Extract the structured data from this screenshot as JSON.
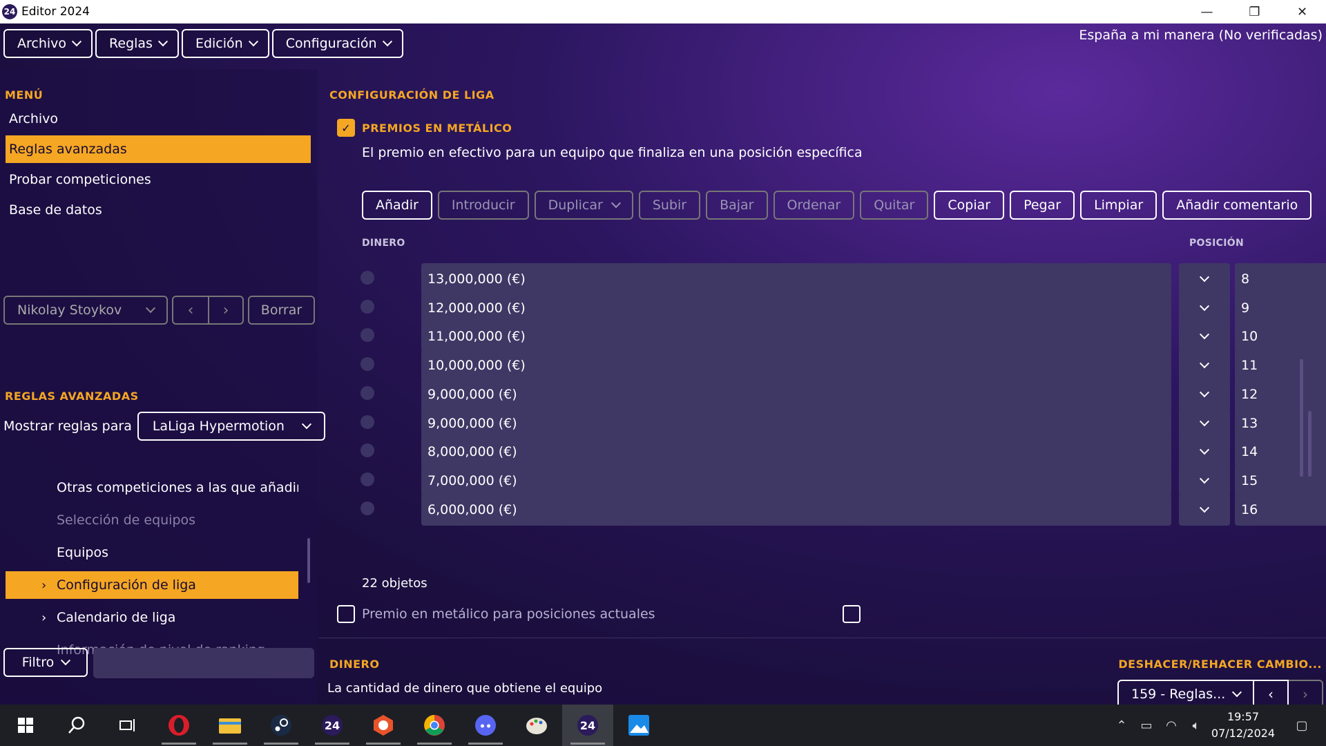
{
  "window": {
    "title": "Editor 2024",
    "app_icon_text": "24"
  },
  "menubar": {
    "items": [
      "Archivo",
      "Reglas",
      "Edición",
      "Configuración"
    ],
    "profile": "España a mi manera (No verificadas)"
  },
  "left": {
    "menu_title": "MENÚ",
    "menu_items": [
      "Archivo",
      "Reglas avanzadas",
      "Probar competiciones",
      "Base de datos"
    ],
    "user": {
      "name": "Nikolay Stoykov",
      "prev": "‹",
      "next": "›",
      "delete": "Borrar"
    },
    "rules_title": "REGLAS AVANZADAS",
    "show_rules_label": "Mostrar reglas para",
    "league": "LaLiga Hypermotion",
    "tree": [
      {
        "label": "Otras competiciones a las que añadir fi",
        "state": "normal",
        "arrow": ""
      },
      {
        "label": "Selección de equipos",
        "state": "dim",
        "arrow": ""
      },
      {
        "label": "Equipos",
        "state": "normal",
        "arrow": ""
      },
      {
        "label": "Configuración de liga",
        "state": "active",
        "arrow": "›"
      },
      {
        "label": "Calendario de liga",
        "state": "normal",
        "arrow": "›"
      },
      {
        "label": "Información de nivel de ranking",
        "state": "dim",
        "arrow": ""
      }
    ],
    "filter_label": "Filtro"
  },
  "right": {
    "title": "CONFIGURACIÓN DE LIGA",
    "prize_title": "PREMIOS EN METÁLICO",
    "prize_desc": "El premio en efectivo para un equipo que finaliza en una posición específica",
    "toolbar": [
      {
        "label": "Añadir",
        "enabled": true
      },
      {
        "label": "Introducir",
        "enabled": false
      },
      {
        "label": "Duplicar",
        "enabled": false,
        "dropdown": true
      },
      {
        "label": "Subir",
        "enabled": false
      },
      {
        "label": "Bajar",
        "enabled": false
      },
      {
        "label": "Ordenar",
        "enabled": false
      },
      {
        "label": "Quitar",
        "enabled": false
      },
      {
        "label": "Copiar",
        "enabled": true
      },
      {
        "label": "Pegar",
        "enabled": true
      },
      {
        "label": "Limpiar",
        "enabled": true
      },
      {
        "label": "Añadir comentario",
        "enabled": true
      }
    ],
    "col_money": "DINERO",
    "col_position": "POSICIÓN",
    "rows": [
      {
        "money": "13,000,000 (€)",
        "position": "8"
      },
      {
        "money": "12,000,000 (€)",
        "position": "9"
      },
      {
        "money": "11,000,000 (€)",
        "position": "10"
      },
      {
        "money": "10,000,000 (€)",
        "position": "11"
      },
      {
        "money": "9,000,000 (€)",
        "position": "12"
      },
      {
        "money": "9,000,000 (€)",
        "position": "13"
      },
      {
        "money": "8,000,000 (€)",
        "position": "14"
      },
      {
        "money": "7,000,000 (€)",
        "position": "15"
      },
      {
        "money": "6,000,000 (€)",
        "position": "16"
      }
    ],
    "count": "22 objetos",
    "current_positions_label": "Premio en metálico para posiciones actuales",
    "money_section_title": "DINERO",
    "money_section_desc": "La cantidad de dinero que obtiene el equipo",
    "undo_title": "DESHACER/REHACER CAMBIO...",
    "undo_value": "159 - Reglas..."
  },
  "taskbar": {
    "time": "19:57",
    "date": "07/12/2024",
    "apps": [
      "windows-start",
      "search",
      "task-view",
      "opera",
      "file-explorer",
      "steam",
      "fm24-launcher",
      "fm-tool",
      "chrome",
      "discord",
      "paint",
      "fm24-editor",
      "photos"
    ]
  },
  "colors": {
    "accent": "#f5a623",
    "field": "#3f3764"
  }
}
